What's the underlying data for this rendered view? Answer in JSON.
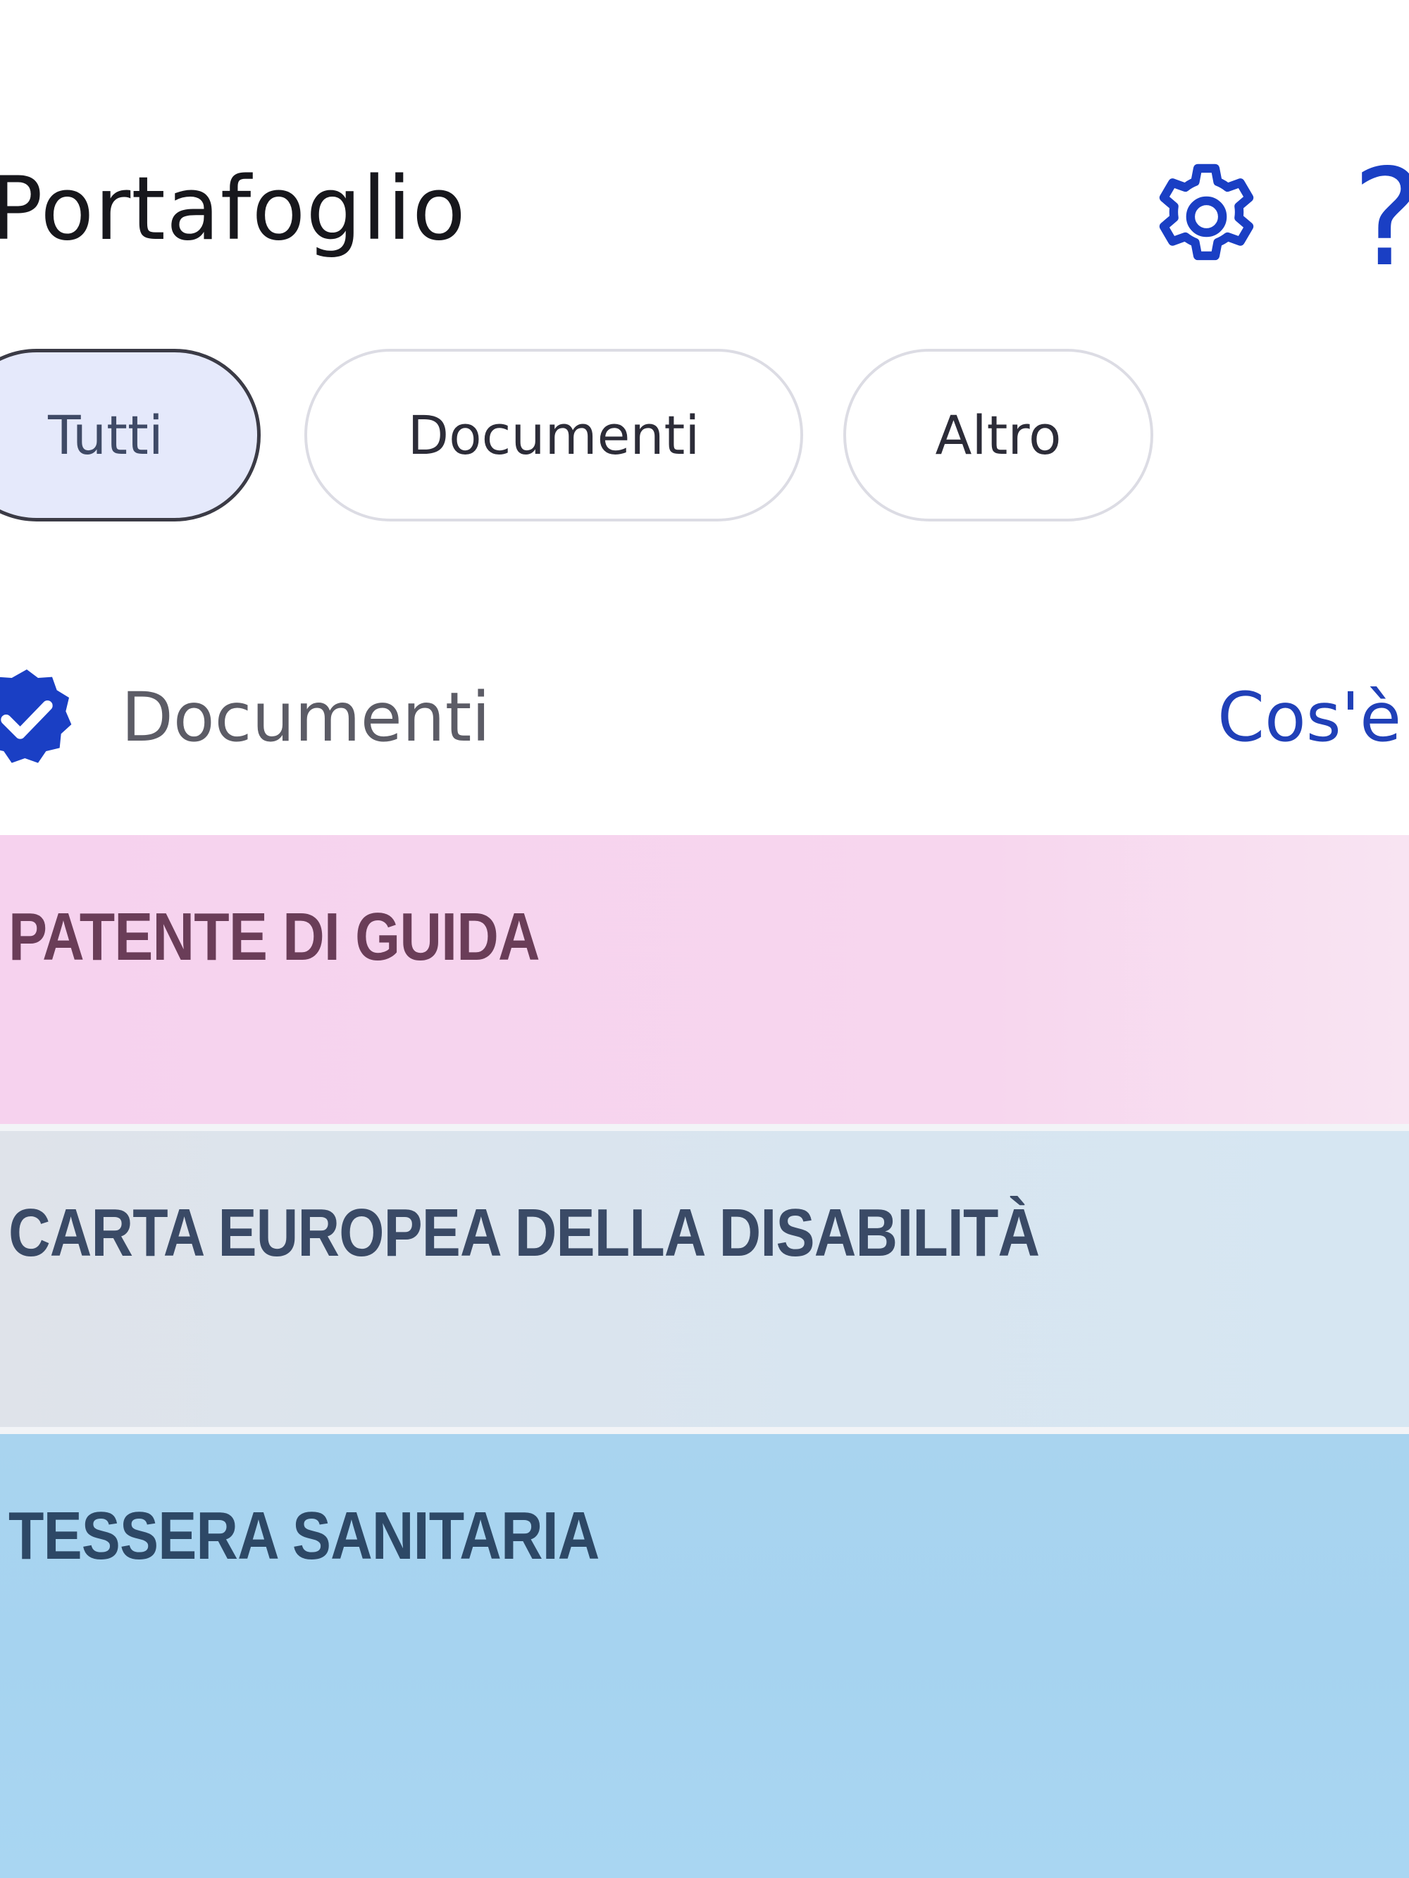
{
  "header": {
    "title": "Portafoglio",
    "settings_icon": "gear-icon",
    "help_icon": "help-icon",
    "help_glyph": "?"
  },
  "filters": {
    "chips": [
      {
        "label": "Tutti",
        "selected": true
      },
      {
        "label": "Documenti",
        "selected": false
      },
      {
        "label": "Altro",
        "selected": false
      }
    ]
  },
  "section": {
    "title": "Documenti",
    "link_label": "Cos'è",
    "badge_icon": "verified-check-icon"
  },
  "cards": [
    {
      "label": "PATENTE DI GUIDA",
      "color": "#f6d2ee"
    },
    {
      "label": "CARTA EUROPEA DELLA DISABILITÀ",
      "color": "#dbe4ee"
    },
    {
      "label": "TESSERA SANITARIA",
      "color": "#a8d5f1"
    }
  ],
  "colors": {
    "accent": "#1a3fc4",
    "chip_selected_bg": "#e5e9fb"
  }
}
